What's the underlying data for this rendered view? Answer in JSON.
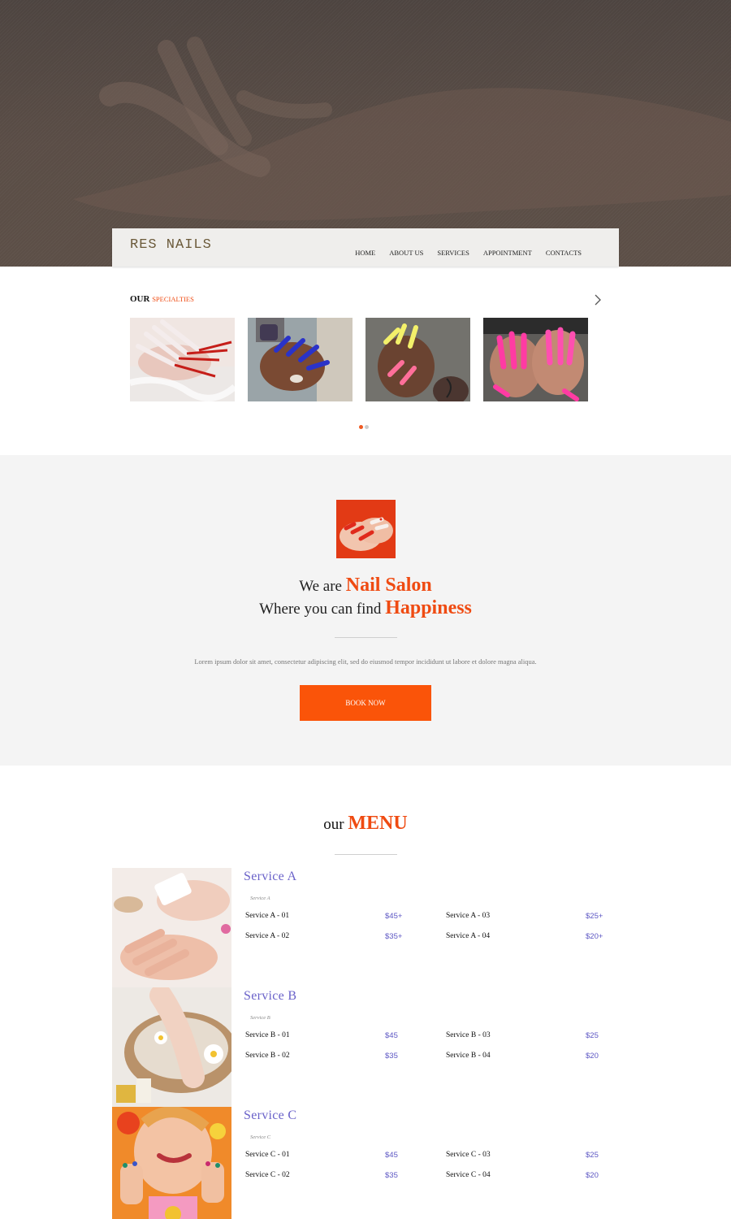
{
  "nav": {
    "brand": "RES NAILS",
    "links": [
      "HOME",
      "ABOUT US",
      "SERVICES",
      "APPOINTMENT",
      "CONTACTS"
    ]
  },
  "specialties": {
    "title_bold": "OUR",
    "title_accent": "SPECIALTIES",
    "next_icon": "chevron-right-icon",
    "thumbnails": [
      "nail-photo-1",
      "nail-photo-2",
      "nail-photo-3",
      "nail-photo-4"
    ],
    "carousel_dots": 2,
    "active_dot": 0
  },
  "about": {
    "line1_prefix": "We are",
    "line1_highlight": "Nail Salon",
    "line2_prefix": "Where you can find",
    "line2_highlight": "Happiness",
    "body": "Lorem ipsum dolor sit amet, consectetur adipiscing elit, sed do eiusmod tempor incididunt ut labore et dolore magna aliqua.",
    "button": "BOOK NOW"
  },
  "menu": {
    "title_prefix": "our",
    "title_highlight": "MENU",
    "services": [
      {
        "name": "Service A",
        "subtitle": "Service A",
        "items": [
          {
            "name": "Service A - 01",
            "price": "$45+"
          },
          {
            "name": "Service A - 02",
            "price": "$35+"
          },
          {
            "name": "Service A - 03",
            "price": "$25+"
          },
          {
            "name": "Service A - 04",
            "price": "$20+"
          }
        ]
      },
      {
        "name": "Service B",
        "subtitle": "Service B",
        "items": [
          {
            "name": "Service B - 01",
            "price": "$45"
          },
          {
            "name": "Service B - 02",
            "price": "$35"
          },
          {
            "name": "Service B - 03",
            "price": "$25"
          },
          {
            "name": "Service B - 04",
            "price": "$20"
          }
        ]
      },
      {
        "name": "Service C",
        "subtitle": "Service C",
        "items": [
          {
            "name": "Service C - 01",
            "price": "$45"
          },
          {
            "name": "Service C - 02",
            "price": "$35"
          },
          {
            "name": "Service C - 03",
            "price": "$25"
          },
          {
            "name": "Service C - 04",
            "price": "$20"
          }
        ]
      }
    ]
  },
  "colors": {
    "accent": "#ef4b12",
    "button": "#fa5409",
    "service_name": "#6a62c9",
    "price": "#5d57c4",
    "hero": "#56493f"
  }
}
